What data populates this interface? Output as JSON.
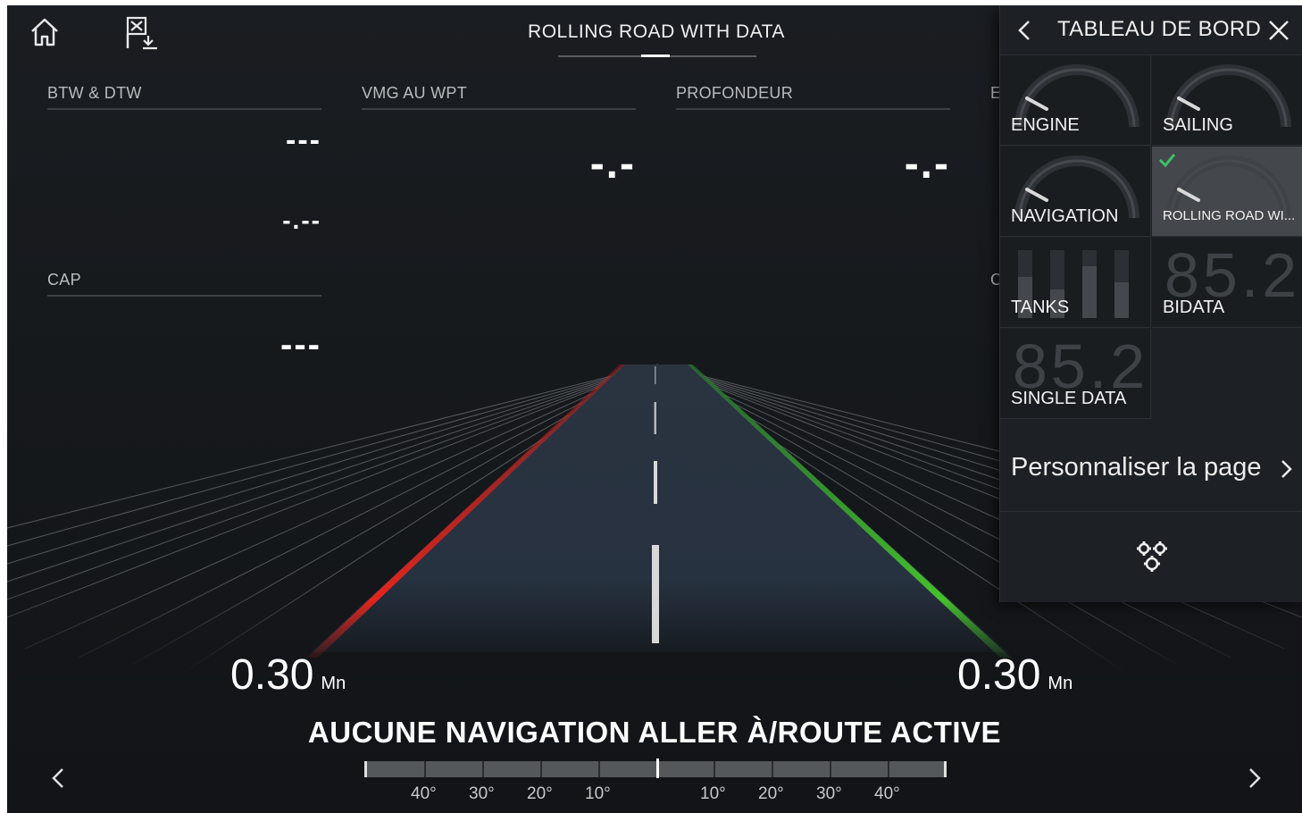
{
  "top_bar": {
    "home_icon": "home-icon",
    "waypoint_icon": "waypoint-flag-icon",
    "page_title": "ROLLING ROAD WITH DATA"
  },
  "data_boxes": [
    {
      "label": "BTW & DTW",
      "value_1": "---",
      "value_2": "-.--"
    },
    {
      "label": "VMG AU WPT",
      "value": "-.-"
    },
    {
      "label": "PROFONDEUR",
      "value": "-.-"
    },
    {
      "label": "CAP",
      "value": "---"
    }
  ],
  "partial_labels": {
    "right_top": "E",
    "right_mid": "C"
  },
  "road": {
    "left_distance": "0.30",
    "left_unit": "Mn",
    "right_distance": "0.30",
    "right_unit": "Mn",
    "status": "AUCUNE NAVIGATION ALLER À/ROUTE ACTIVE",
    "left_lane_color": "#e0261e",
    "right_lane_color": "#3fbf2a"
  },
  "scale": {
    "labels_left": [
      "40°",
      "30°",
      "20°",
      "10°"
    ],
    "labels_right": [
      "10°",
      "20°",
      "30°",
      "40°"
    ]
  },
  "panel": {
    "title": "TABLEAU DE BORD",
    "back_icon": "chevron-left-icon",
    "close_icon": "close-icon",
    "tiles": [
      {
        "label": "ENGINE",
        "thumb": "gauge",
        "selected": false
      },
      {
        "label": "SAILING",
        "thumb": "gauge",
        "selected": false
      },
      {
        "label": "NAVIGATION",
        "thumb": "gauge",
        "selected": false
      },
      {
        "label": "ROLLING ROAD WI...",
        "thumb": "gauge",
        "selected": true
      },
      {
        "label": "TANKS",
        "thumb": "bars",
        "selected": false
      },
      {
        "label": "BIDATA",
        "thumb": "number",
        "thumb_text": "85.2",
        "selected": false
      },
      {
        "label": "SINGLE DATA",
        "thumb": "number",
        "thumb_text": "85.2",
        "selected": false
      }
    ],
    "customize_label": "Personnaliser la page",
    "settings_icon": "settings-gears-icon",
    "accent_color": "#3cc06a"
  },
  "nav": {
    "prev_icon": "chevron-left-icon",
    "next_icon": "chevron-right-icon"
  }
}
